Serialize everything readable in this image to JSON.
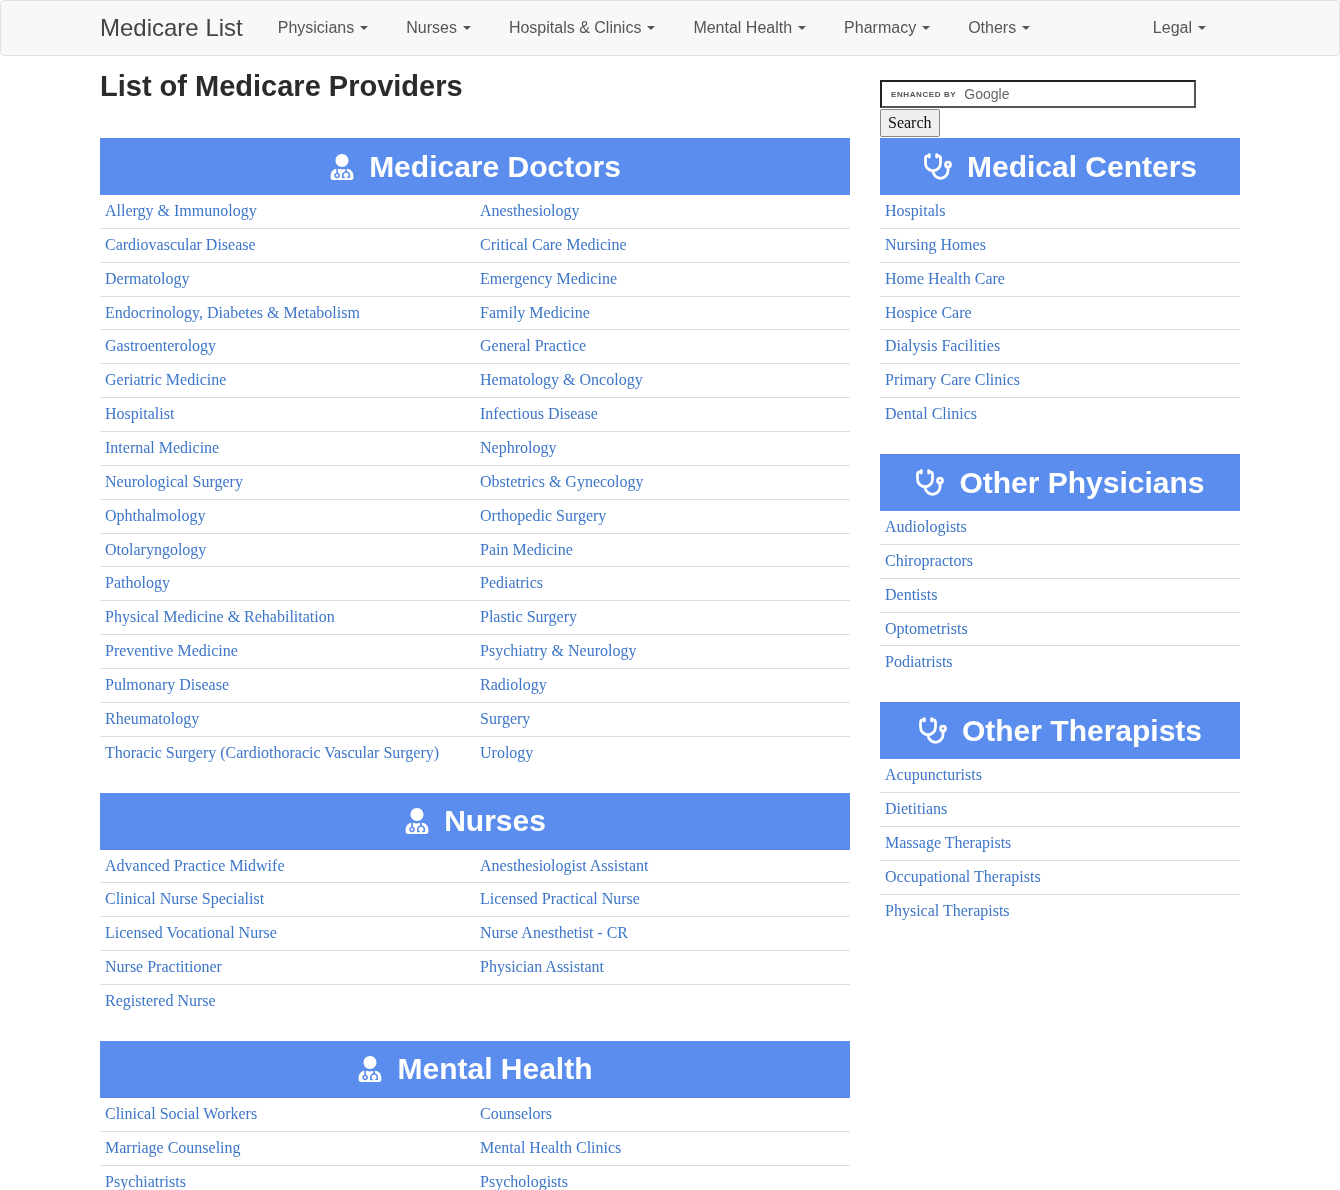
{
  "navbar": {
    "brand": "Medicare List",
    "menus": [
      {
        "label": "Physicians"
      },
      {
        "label": "Nurses"
      },
      {
        "label": "Hospitals & Clinics"
      },
      {
        "label": "Mental Health"
      },
      {
        "label": "Pharmacy"
      },
      {
        "label": "Others"
      }
    ],
    "right_menus": [
      {
        "label": "Legal"
      }
    ]
  },
  "page_title": "List of Medicare Providers",
  "main_sections": [
    {
      "title": "Medicare Doctors",
      "links": [
        "Allergy & Immunology",
        "Anesthesiology",
        "Cardiovascular Disease",
        "Critical Care Medicine",
        "Dermatology",
        "Emergency Medicine",
        "Endocrinology, Diabetes & Metabolism",
        "Family Medicine",
        "Gastroenterology",
        "General Practice",
        "Geriatric Medicine",
        "Hematology & Oncology",
        "Hospitalist",
        "Infectious Disease",
        "Internal Medicine",
        "Nephrology",
        "Neurological Surgery",
        "Obstetrics & Gynecology",
        "Ophthalmology",
        "Orthopedic Surgery",
        "Otolaryngology",
        "Pain Medicine",
        "Pathology",
        "Pediatrics",
        "Physical Medicine & Rehabilitation",
        "Plastic Surgery",
        "Preventive Medicine",
        "Psychiatry & Neurology",
        "Pulmonary Disease",
        "Radiology",
        "Rheumatology",
        "Surgery",
        "Thoracic Surgery (Cardiothoracic Vascular Surgery)",
        "Urology"
      ]
    },
    {
      "title": "Nurses",
      "links": [
        "Advanced Practice Midwife",
        "Anesthesiologist Assistant",
        "Clinical Nurse Specialist",
        "Licensed Practical Nurse",
        "Licensed Vocational Nurse",
        "Nurse Anesthetist - CR",
        "Nurse Practitioner",
        "Physician Assistant",
        "Registered Nurse"
      ]
    },
    {
      "title": "Mental Health",
      "links": [
        "Clinical Social Workers",
        "Counselors",
        "Marriage Counseling",
        "Mental Health Clinics",
        "Psychiatrists",
        "Psychologists"
      ]
    }
  ],
  "sidebar": {
    "search": {
      "branding": "ENHANCED BY",
      "brand": "Google",
      "button": "Search"
    },
    "sections": [
      {
        "title": "Medical Centers",
        "links": [
          "Hospitals",
          "Nursing Homes",
          "Home Health Care",
          "Hospice Care",
          "Dialysis Facilities",
          "Primary Care Clinics",
          "Dental Clinics"
        ]
      },
      {
        "title": "Other Physicians",
        "links": [
          "Audiologists",
          "Chiropractors",
          "Dentists",
          "Optometrists",
          "Podiatrists"
        ]
      },
      {
        "title": "Other Therapists",
        "links": [
          "Acupuncturists",
          "Dietitians",
          "Massage Therapists",
          "Occupational Therapists",
          "Physical Therapists"
        ]
      }
    ]
  }
}
